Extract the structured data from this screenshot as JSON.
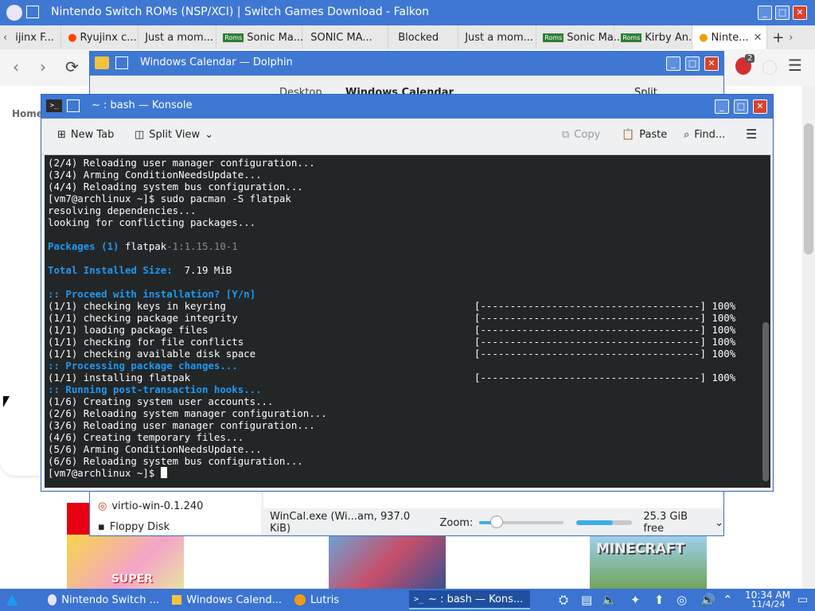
{
  "falkon": {
    "title": "Nintendo Switch ROMs (NSP/XCI) | Switch Games Download - Falkon",
    "tabs": [
      {
        "label": "ijinx F..."
      },
      {
        "label": "Ryujinx c..."
      },
      {
        "label": "Just a mom..."
      },
      {
        "label": "Sonic Ma..."
      },
      {
        "label": "SONIC MA..."
      },
      {
        "label": "Blocked"
      },
      {
        "label": "Just a mom..."
      },
      {
        "label": "Sonic Ma..."
      },
      {
        "label": "Kirby An..."
      },
      {
        "label": "Ninte..."
      }
    ],
    "new_tab_glyph": "+",
    "badge_count": "2",
    "page": {
      "home_label": "Home",
      "game_super": "SUPER",
      "game_minecraft": "MINECRAFT"
    }
  },
  "dolphin": {
    "title": "Windows Calendar — Dolphin",
    "breadcrumb": [
      "Desktop",
      "Windows Calendar"
    ],
    "split_label": "Split",
    "places": [
      "virtio-win-0.1.240",
      "Floppy Disk"
    ],
    "status": "WinCal.exe (Wi...am, 937.0 KiB)",
    "zoom_label": "Zoom:",
    "zoom_level": 0.2,
    "free_space": "25.3 GiB free"
  },
  "konsole": {
    "title": "~ : bash — Konsole",
    "toolbar": {
      "new_tab": "New Tab",
      "split_view": "Split View",
      "copy": "Copy",
      "paste": "Paste",
      "find": "Find..."
    },
    "lines": [
      {
        "text": "(2/4) Reloading user manager configuration...",
        "style": ""
      },
      {
        "text": "(3/4) Arming ConditionNeedsUpdate...",
        "style": ""
      },
      {
        "text": "(4/4) Reloading system bus configuration...",
        "style": ""
      },
      {
        "text": "[vm7@archlinux ~]$ sudo pacman -S flatpak",
        "style": ""
      },
      {
        "text": "resolving dependencies...",
        "style": ""
      },
      {
        "text": "looking for conflicting packages...",
        "style": ""
      },
      {
        "text": "",
        "style": ""
      },
      {
        "text": "Packages (1)",
        "style": "blue",
        "rest": " flatpak",
        "dim": "-1:1.15.10-1"
      },
      {
        "text": "",
        "style": ""
      },
      {
        "text": "Total Installed Size:",
        "style": "blue",
        "rest": "  7.19 MiB"
      },
      {
        "text": "",
        "style": ""
      },
      {
        "text": ":: Proceed with installation? [Y/n]",
        "style": "blue"
      },
      {
        "text": "(1/1) checking keys in keyring",
        "style": "",
        "bar": "[-------------------------------------] 100%"
      },
      {
        "text": "(1/1) checking package integrity",
        "style": "",
        "bar": "[-------------------------------------] 100%"
      },
      {
        "text": "(1/1) loading package files",
        "style": "",
        "bar": "[-------------------------------------] 100%"
      },
      {
        "text": "(1/1) checking for file conflicts",
        "style": "",
        "bar": "[-------------------------------------] 100%"
      },
      {
        "text": "(1/1) checking available disk space",
        "style": "",
        "bar": "[-------------------------------------] 100%"
      },
      {
        "text": ":: Processing package changes...",
        "style": "blue"
      },
      {
        "text": "(1/1) installing flatpak",
        "style": "",
        "bar": "[-------------------------------------] 100%"
      },
      {
        "text": ":: Running post-transaction hooks...",
        "style": "blue"
      },
      {
        "text": "(1/6) Creating system user accounts...",
        "style": ""
      },
      {
        "text": "(2/6) Reloading system manager configuration...",
        "style": ""
      },
      {
        "text": "(3/6) Reloading user manager configuration...",
        "style": ""
      },
      {
        "text": "(4/6) Creating temporary files...",
        "style": ""
      },
      {
        "text": "(5/6) Arming ConditionNeedsUpdate...",
        "style": ""
      },
      {
        "text": "(6/6) Reloading system bus configuration...",
        "style": ""
      },
      {
        "text": "[vm7@archlinux ~]$ ",
        "style": "",
        "cursor": true
      }
    ]
  },
  "taskbar": {
    "tasks": [
      {
        "label": "Nintendo Switch ..."
      },
      {
        "label": "Windows Calend..."
      },
      {
        "label": "Lutris"
      },
      {
        "label": "~ : bash — Kons..."
      }
    ],
    "time": "10:34 AM",
    "date": "11/4/24"
  },
  "colors": {
    "titlebar": "#3f78d3",
    "terminal_bg": "#232627",
    "accent_blue": "#1d99f3",
    "taskbar": "#3b74d1"
  }
}
